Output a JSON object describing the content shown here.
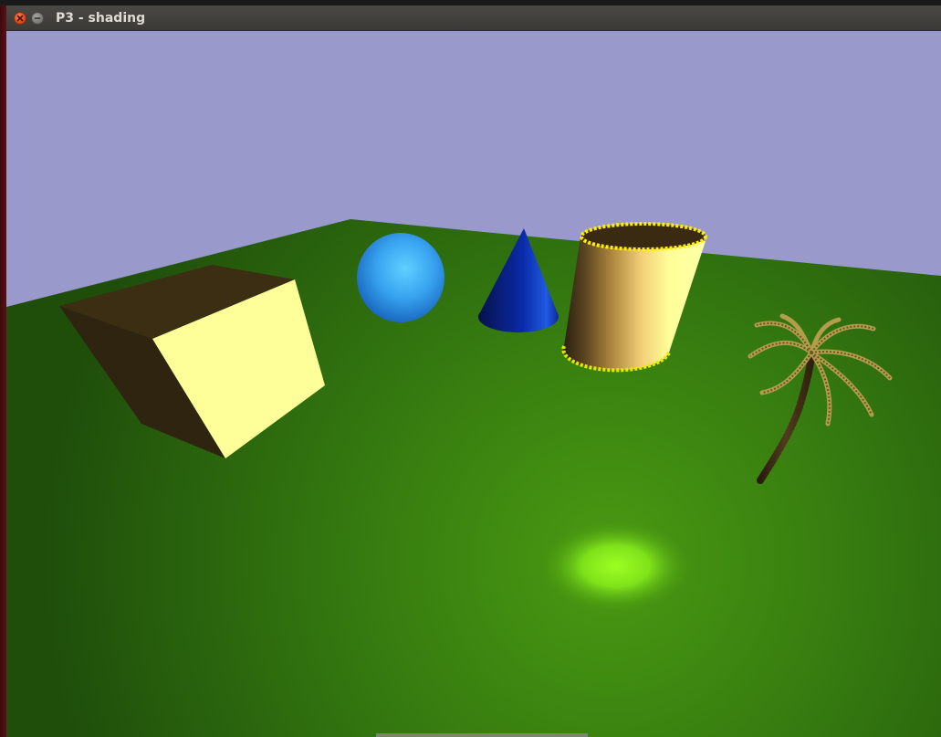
{
  "window": {
    "title": "P3 - shading"
  },
  "icons": {
    "close": "close-icon",
    "minimize": "minimize-icon"
  },
  "colors": {
    "sky": "#9999cc",
    "ground": "#2c6a10",
    "spotlight": "#8fff20",
    "sphere": "#3aa7f2",
    "cone": "#0a2fb0",
    "cube_lit": "#ffff99",
    "cube_dark": "#3a3010",
    "cylinder_rim": "#ffff00",
    "palm_leaf": "#b8a050"
  }
}
